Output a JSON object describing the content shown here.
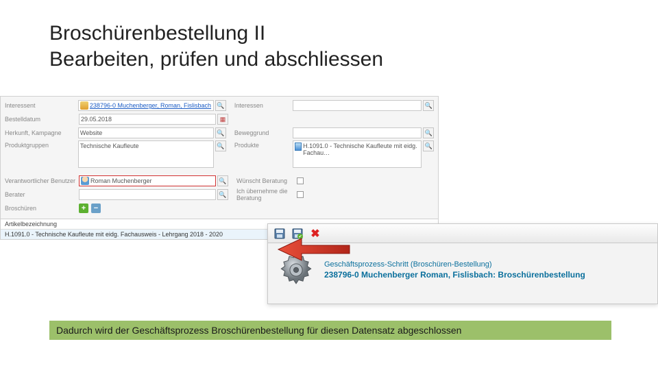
{
  "slide": {
    "title": "Broschürenbestellung II",
    "subtitle": "Bearbeiten, prüfen und abschliessen"
  },
  "form": {
    "rows": {
      "interessent": {
        "label": "Interessent",
        "value": "238796-0 Muchenberger, Roman, Fislisbach"
      },
      "interessen": {
        "label": "Interessen"
      },
      "bestelldatum": {
        "label": "Bestelldatum",
        "value": "29.05.2018"
      },
      "herkunft": {
        "label": "Herkunft, Kampagne",
        "value": "Website"
      },
      "beweggrund": {
        "label": "Beweggrund"
      },
      "produktgruppen": {
        "label": "Produktgruppen",
        "value": "Technische Kaufleute"
      },
      "produkte": {
        "label": "Produkte",
        "value": "H.1091.0 - Technische Kaufleute mit eidg. Fachau…"
      },
      "verantw": {
        "label": "Verantwortlicher Benutzer",
        "value": "Roman Muchenberger"
      },
      "wunschtberatung": {
        "label": "Wünscht Beratung"
      },
      "berater": {
        "label": "Berater"
      },
      "ichuebernehme": {
        "label": "Ich übernehme die Beratung"
      },
      "broschueren": {
        "label": "Broschüren"
      }
    },
    "table": {
      "header": "Artikelbezeichnung",
      "row1": "H.1091.0 - Technische Kaufleute mit eidg. Fachausweis - Lehrgang 2018 - 2020"
    }
  },
  "process": {
    "line1": "Geschäftsprozess-Schritt (Broschüren-Bestellung)",
    "line2": "238796-0 Muchenberger Roman, Fislisbach: Broschürenbestellung"
  },
  "footer": {
    "text": "Dadurch wird der Geschäftsprozess Broschürenbestellung für diesen Datensatz abgeschlossen"
  }
}
